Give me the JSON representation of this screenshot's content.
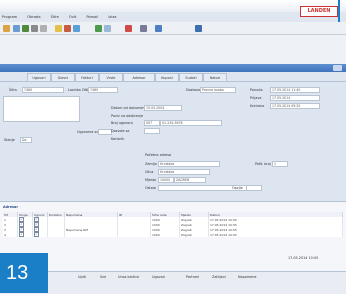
{
  "menu": [
    "Program",
    "Obrada",
    "Šifre",
    "Ovit",
    "Pomoć",
    "Izlaz"
  ],
  "brand": {
    "logo_text": "LANDEN",
    "accent": "#1a7fc6"
  },
  "tabs": [
    "Ugovori",
    "Glavni",
    "Fakturi",
    "Vrste",
    "Adresar",
    "Kuponi",
    "Sudski",
    "Nalozi"
  ],
  "form": {
    "sifra_label": "Šifra",
    "sifra_value": "7480",
    "lozinka_label": "Lozinka ONL",
    "lozinka_value": "7480",
    "dostava_label": "Dostava",
    "dostava_value": "Poštom",
    "ponuda_label": "Ponuda",
    "ponuda_value": "17.05.2014 11:40",
    "prijava_label": "Prijava",
    "prijava_value": "17.05.2014",
    "kreiran_label": "Kreirano",
    "kreiran_value": "17.05.2014 09:20",
    "datum_label": "Datum od dokumenta",
    "datum_value": "15.05.2004",
    "poziv_label": "Poziv na odobrenje",
    "broj_label": "Broj ugovora",
    "broj_value": "007",
    "ugovorni_label": "Ugovorna suma",
    "dozvole_label": "Dozvole za",
    "korisnik_label": "Korisnik",
    "pocetna_label": "Početna adresa",
    "zemlja_label": "Zemlja",
    "zemlja_value": "Hrvatska",
    "ulica_label": "Ulica",
    "ulica_value": "Hrvatska",
    "mjesto_label": "Mjesto",
    "mjesto_value": "10000",
    "mjesto_name": "ZAGREB",
    "ostalo_label": "Ostalo",
    "postbr_label": "Pošt. broj",
    "postbr_value": "1",
    "uslovi_label": "Uslovi",
    "uslovi_value": "Da",
    "opcije_label": "Opcije",
    "left_section": "Stanje",
    "left_value": "Da",
    "sel_value": "Pravna osoba",
    "telefon_label": "Telefon",
    "telefon_value": "01-234-5678"
  },
  "grid": {
    "section_label": "Adresar",
    "headers": [
      "Šif",
      "Uloga",
      "Ugovor",
      "Dodatno",
      "Napomena",
      "ID",
      "Šifra rada",
      "Mjesto",
      "Datum"
    ],
    "rows": [
      [
        "1",
        "✓",
        "✓",
        "",
        "",
        "",
        "1000",
        "Zagreb",
        "17.05.2014 10:05"
      ],
      [
        "2",
        "✓",
        "✓",
        "",
        "",
        "",
        "1000",
        "Zagreb",
        "17.05.2014 10:05"
      ],
      [
        "3",
        "✓",
        "✓",
        "",
        "Napomena RM",
        "",
        "1000",
        "Zagreb",
        "17.05.2014 10:05"
      ],
      [
        "4",
        "✓",
        "✓",
        "",
        "",
        "",
        "1000",
        "Zagreb",
        "17.05.2014 10:05"
      ]
    ],
    "footer_date": "17.05.2014 10:05"
  },
  "status": [
    "Upiti",
    "Sve",
    "Unos kartice",
    "Ugovori",
    "Partneri",
    "Zahtjevi",
    "Napomene"
  ],
  "badge": {
    "number": "13",
    "bg": "#1a7fc6"
  }
}
